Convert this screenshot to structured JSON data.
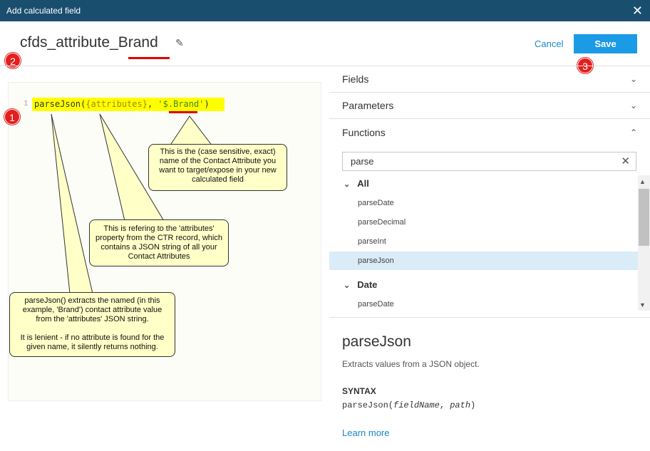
{
  "dialog": {
    "title": "Add calculated field",
    "close_glyph": "✕"
  },
  "header": {
    "field_name": "cfds_attribute_Brand",
    "cancel_label": "Cancel",
    "save_label": "Save",
    "edit_icon": "pencil-icon"
  },
  "badges": [
    "1",
    "2",
    "3"
  ],
  "editor": {
    "line_number": "1",
    "code": {
      "fn_open": "parseJson(",
      "attr": "{attributes}",
      "sep": ", ",
      "str_pre": "'$.",
      "str_key": "Brand",
      "str_post": "'",
      "close": ")"
    }
  },
  "callouts": {
    "brand": "This is the (case sensitive, exact) name of the Contact Attribute you want to target/expose in your new calculated field",
    "attributes": "This is refering to the 'attributes' property from the CTR record, which contains a JSON string of all your Contact Attributes",
    "parsejson_1": "parseJson() extracts the named (in this example, 'Brand') contact attribute value from the 'attributes' JSON string.",
    "parsejson_2": "It is lenient - if no attribute is found for the given name, it silently returns nothing."
  },
  "sidebar": {
    "sections": [
      {
        "label": "Fields",
        "state": "collapsed"
      },
      {
        "label": "Parameters",
        "state": "collapsed"
      },
      {
        "label": "Functions",
        "state": "expanded"
      }
    ],
    "search": {
      "value": "parse",
      "clear_glyph": "✕"
    },
    "groups": [
      {
        "label": "All",
        "items": [
          "parseDate",
          "parseDecimal",
          "parseInt",
          "parseJson"
        ]
      },
      {
        "label": "Date",
        "items": [
          "parseDate"
        ]
      }
    ],
    "selected_item": "parseJson"
  },
  "detail": {
    "title": "parseJson",
    "description": "Extracts values from a JSON object.",
    "syntax_heading": "SYNTAX",
    "syntax_fn": "parseJson(",
    "syntax_arg1": "fieldName",
    "syntax_sep": ", ",
    "syntax_arg2": "path",
    "syntax_close": ")",
    "learn_more": "Learn more"
  },
  "colors": {
    "titlebar": "#1a4e6e",
    "primary": "#1b9ae6",
    "link": "#1a87c5",
    "highlight": "#ffff00",
    "callout": "#ffffc8",
    "badge": "#e41e1e",
    "selected_row": "#d9ecf8"
  }
}
